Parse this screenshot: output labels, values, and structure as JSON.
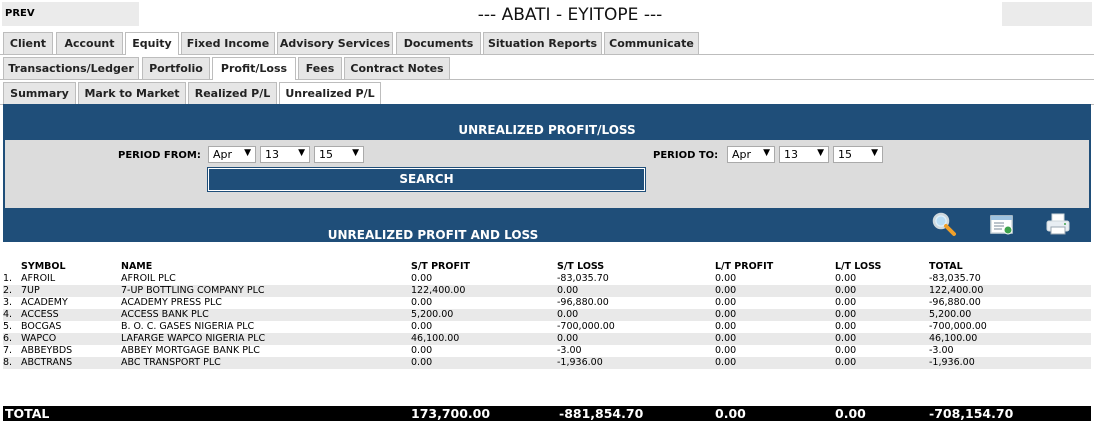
{
  "header": {
    "prev_label": "PREV",
    "title": "--- ABATI - EYITOPE ---"
  },
  "tabs_main": [
    "Client",
    "Account",
    "Equity",
    "Fixed Income",
    "Advisory Services",
    "Documents",
    "Situation Reports",
    "Communicate"
  ],
  "tabs_main_active": "Equity",
  "tabs_equity": [
    "Transactions/Ledger",
    "Portfolio",
    "Profit/Loss",
    "Fees",
    "Contract Notes"
  ],
  "tabs_equity_active": "Profit/Loss",
  "tabs_pl": [
    "Summary",
    "Mark to Market",
    "Realized P/L",
    "Unrealized P/L"
  ],
  "tabs_pl_active": "Unrealized P/L",
  "filter": {
    "heading": "UNREALIZED PROFIT/LOSS",
    "from_label": "PERIOD FROM:",
    "from_month": "Apr",
    "from_day": "13",
    "from_year": "15",
    "to_label": "PERIOD TO:",
    "to_month": "Apr",
    "to_day": "13",
    "to_year": "15",
    "search_label": "SEARCH"
  },
  "results": {
    "heading": "UNREALIZED PROFIT AND LOSS",
    "tools": [
      "search-icon",
      "export-icon",
      "print-icon"
    ],
    "columns": [
      "SYMBOL",
      "NAME",
      "S/T PROFIT",
      "S/T LOSS",
      "L/T PROFIT",
      "L/T LOSS",
      "TOTAL"
    ],
    "rows": [
      {
        "n": "1.",
        "symbol": "AFROIL",
        "name": "AFROIL PLC",
        "st_profit": "0.00",
        "st_loss": "-83,035.70",
        "lt_profit": "0.00",
        "lt_loss": "0.00",
        "total": "-83,035.70"
      },
      {
        "n": "2.",
        "symbol": "7UP",
        "name": "7-UP BOTTLING COMPANY PLC",
        "st_profit": "122,400.00",
        "st_loss": "0.00",
        "lt_profit": "0.00",
        "lt_loss": "0.00",
        "total": "122,400.00"
      },
      {
        "n": "3.",
        "symbol": "ACADEMY",
        "name": "ACADEMY PRESS PLC",
        "st_profit": "0.00",
        "st_loss": "-96,880.00",
        "lt_profit": "0.00",
        "lt_loss": "0.00",
        "total": "-96,880.00"
      },
      {
        "n": "4.",
        "symbol": "ACCESS",
        "name": "ACCESS BANK PLC",
        "st_profit": "5,200.00",
        "st_loss": "0.00",
        "lt_profit": "0.00",
        "lt_loss": "0.00",
        "total": "5,200.00"
      },
      {
        "n": "5.",
        "symbol": "BOCGAS",
        "name": "B. O. C. GASES NIGERIA PLC",
        "st_profit": "0.00",
        "st_loss": "-700,000.00",
        "lt_profit": "0.00",
        "lt_loss": "0.00",
        "total": "-700,000.00"
      },
      {
        "n": "6.",
        "symbol": "WAPCO",
        "name": "LAFARGE WAPCO NIGERIA PLC",
        "st_profit": "46,100.00",
        "st_loss": "0.00",
        "lt_profit": "0.00",
        "lt_loss": "0.00",
        "total": "46,100.00"
      },
      {
        "n": "7.",
        "symbol": "ABBEYBDS",
        "name": "ABBEY MORTGAGE BANK PLC",
        "st_profit": "0.00",
        "st_loss": "-3.00",
        "lt_profit": "0.00",
        "lt_loss": "0.00",
        "total": "-3.00"
      },
      {
        "n": "8.",
        "symbol": "ABCTRANS",
        "name": "ABC TRANSPORT PLC",
        "st_profit": "0.00",
        "st_loss": "-1,936.00",
        "lt_profit": "0.00",
        "lt_loss": "0.00",
        "total": "-1,936.00"
      }
    ],
    "total": {
      "label": "TOTAL",
      "st_profit": "173,700.00",
      "st_loss": "-881,854.70",
      "lt_profit": "0.00",
      "lt_loss": "0.00",
      "total": "-708,154.70"
    }
  }
}
